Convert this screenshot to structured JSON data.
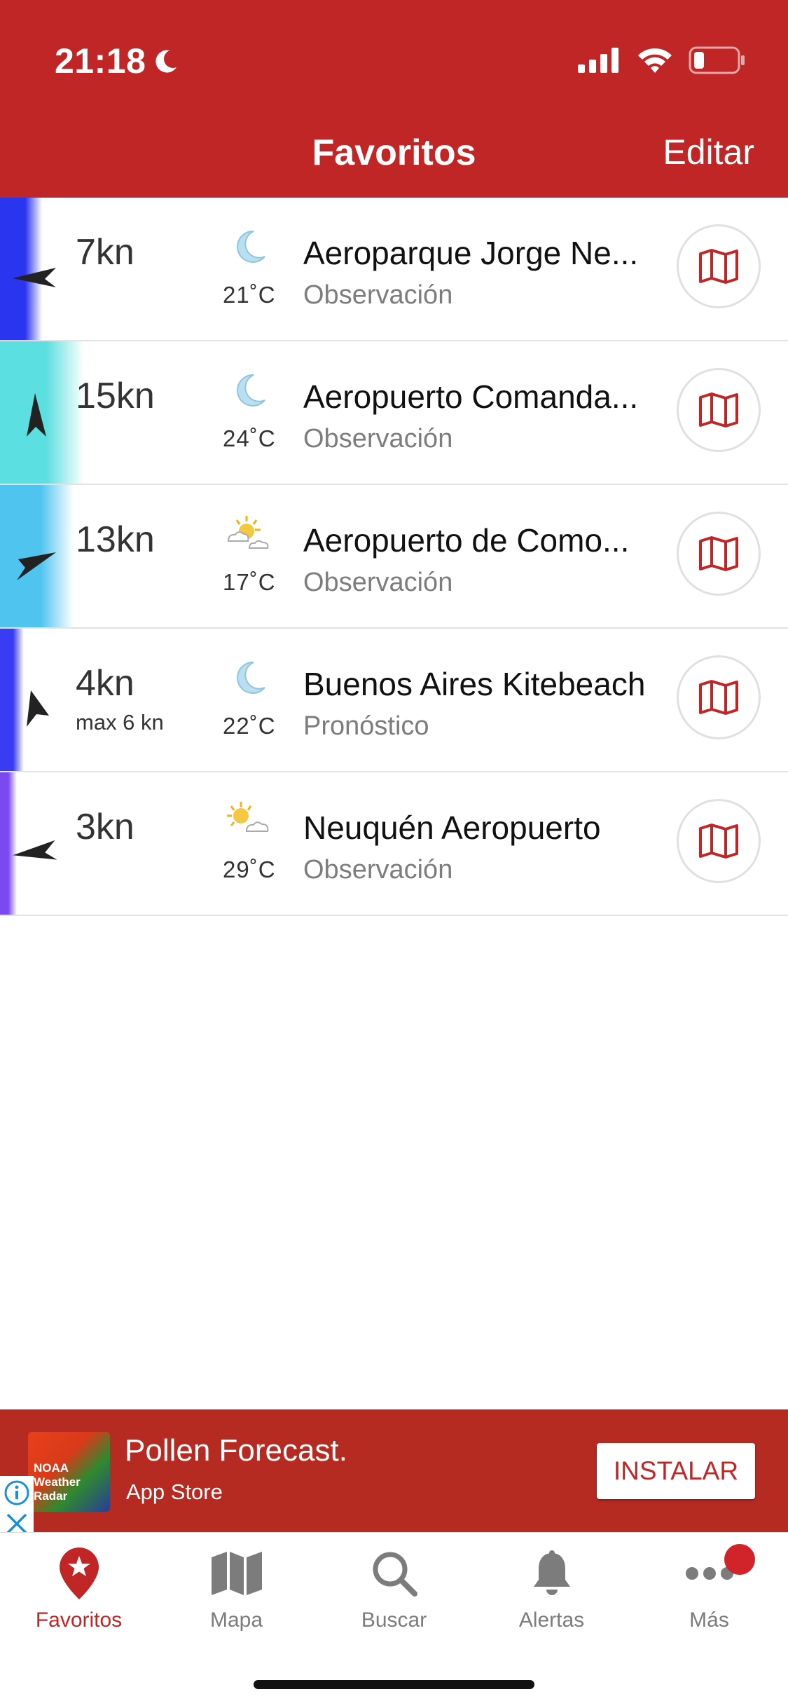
{
  "status_bar": {
    "time": "21:18"
  },
  "nav": {
    "title": "Favoritos",
    "edit_label": "Editar"
  },
  "stations": [
    {
      "speed": "7kn",
      "max": "",
      "temp": "21˚C",
      "name": "Aeroparque Jorge Ne...",
      "type": "Observación",
      "weather_icon": "moon-icon",
      "strip_color": "#2a35f0",
      "wind_direction_deg": 250
    },
    {
      "speed": "15kn",
      "max": "",
      "temp": "24˚C",
      "name": "Aeropuerto Comanda...",
      "type": "Observación",
      "weather_icon": "moon-icon",
      "strip_color": "#5cdfe0",
      "wind_direction_deg": 20
    },
    {
      "speed": "13kn",
      "max": "",
      "temp": "17˚C",
      "name": "Aeropuerto de Como...",
      "type": "Observación",
      "weather_icon": "partly-cloudy-icon",
      "strip_color": "#4fc4ee",
      "wind_direction_deg": 60
    },
    {
      "speed": "4kn",
      "max": "max 6 kn",
      "temp": "22˚C",
      "name": "Buenos Aires Kitebeach",
      "type": "Pronóstico",
      "weather_icon": "moon-icon",
      "strip_color": "#3a3cf2",
      "wind_direction_deg": 30
    },
    {
      "speed": "3kn",
      "max": "",
      "temp": "29˚C",
      "name": "Neuquén Aeropuerto",
      "type": "Observación",
      "weather_icon": "partly-cloudy-icon",
      "strip_color": "#7a4af0",
      "wind_direction_deg": 250
    }
  ],
  "ad": {
    "image_text": "NOAA Weather Radar",
    "title": "Pollen Forecast.",
    "subtitle": "App Store",
    "button_label": "INSTALAR"
  },
  "tabs": [
    {
      "label": "Favoritos",
      "icon": "star-pin-icon",
      "active": true
    },
    {
      "label": "Mapa",
      "icon": "map-icon",
      "active": false
    },
    {
      "label": "Buscar",
      "icon": "search-icon",
      "active": false
    },
    {
      "label": "Alertas",
      "icon": "bell-icon",
      "active": false
    },
    {
      "label": "Más",
      "icon": "more-icon",
      "active": false
    }
  ],
  "colors": {
    "brand": "#c02626",
    "ad_bg": "#b52b22",
    "muted": "#7d7d7d"
  }
}
